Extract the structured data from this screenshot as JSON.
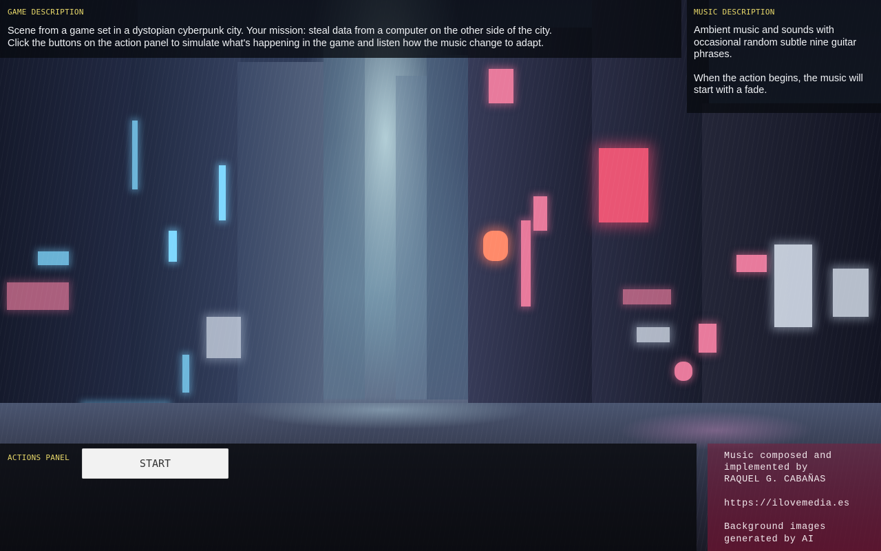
{
  "game_description": {
    "label": "GAME DESCRIPTION",
    "line1": "Scene from a game set in a dystopian cyberpunk city. Your mission: steal data from a computer on the other side of the city.",
    "line2": "Click the buttons on the action panel to simulate what's happening in the game and listen how the music change to adapt."
  },
  "music_description": {
    "label": "MUSIC DESCRIPTION",
    "paragraph1": "Ambient music and sounds with occasional random subtle nine guitar phrases.",
    "paragraph2": "When the action begins, the music will start with a fade."
  },
  "actions_panel": {
    "label": "ACTIONS PANEL",
    "start_label": "START"
  },
  "credits": {
    "line1": "Music composed and",
    "line2": "implemented by",
    "line3": "RAQUEL G. CABAÑAS",
    "url": "https://ilovemedia.es",
    "line4": "Background images",
    "line5": "generated by AI"
  },
  "colors": {
    "label_yellow": "#e8d86a",
    "neon_pink": "#ff5a7a",
    "neon_cyan": "#7fd8ff"
  }
}
